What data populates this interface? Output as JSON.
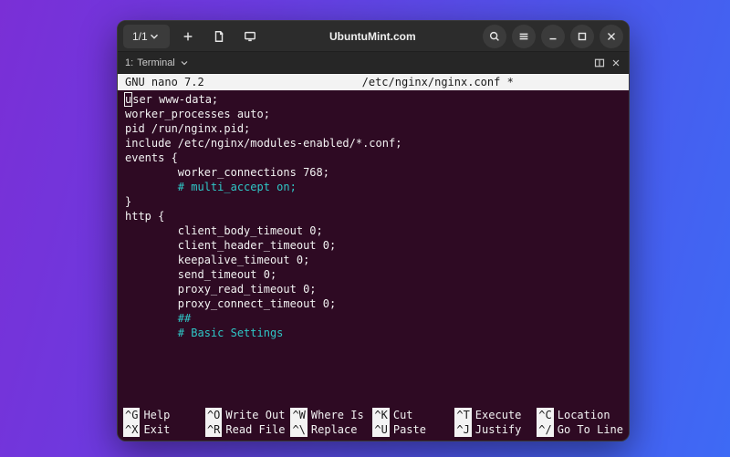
{
  "header": {
    "tab_counter": "1/1",
    "title": "UbuntuMint.com"
  },
  "tabstrip": {
    "tab_index": "1:",
    "tab_label": "Terminal"
  },
  "nano": {
    "app": "GNU nano 7.2",
    "filename": "/etc/nginx/nginx.conf *",
    "lines": [
      {
        "t": "ser www-data;",
        "style": "plain",
        "cursor_first": "u"
      },
      {
        "t": "worker_processes auto;",
        "style": "plain"
      },
      {
        "t": "pid /run/nginx.pid;",
        "style": "plain"
      },
      {
        "t": "include /etc/nginx/modules-enabled/*.conf;",
        "style": "plain"
      },
      {
        "t": "",
        "style": "plain"
      },
      {
        "t": "events {",
        "style": "plain"
      },
      {
        "t": "        worker_connections 768;",
        "style": "plain"
      },
      {
        "t": "        # multi_accept on;",
        "style": "comment"
      },
      {
        "t": "}",
        "style": "plain"
      },
      {
        "t": "",
        "style": "plain"
      },
      {
        "t": "http {",
        "style": "plain"
      },
      {
        "t": "        client_body_timeout 0;",
        "style": "plain"
      },
      {
        "t": "        client_header_timeout 0;",
        "style": "plain"
      },
      {
        "t": "        keepalive_timeout 0;",
        "style": "plain"
      },
      {
        "t": "        send_timeout 0;",
        "style": "plain"
      },
      {
        "t": "        proxy_read_timeout 0;",
        "style": "plain"
      },
      {
        "t": "        proxy_connect_timeout 0;",
        "style": "plain"
      },
      {
        "t": "",
        "style": "plain"
      },
      {
        "t": "        ##",
        "style": "comment"
      },
      {
        "t": "        # Basic Settings",
        "style": "comment"
      }
    ]
  },
  "help": [
    {
      "key": "^G",
      "label": "Help"
    },
    {
      "key": "^O",
      "label": "Write Out"
    },
    {
      "key": "^W",
      "label": "Where Is"
    },
    {
      "key": "^K",
      "label": "Cut"
    },
    {
      "key": "^T",
      "label": "Execute"
    },
    {
      "key": "^C",
      "label": "Location"
    },
    {
      "key": "^X",
      "label": "Exit"
    },
    {
      "key": "^R",
      "label": "Read File"
    },
    {
      "key": "^\\",
      "label": "Replace"
    },
    {
      "key": "^U",
      "label": "Paste"
    },
    {
      "key": "^J",
      "label": "Justify"
    },
    {
      "key": "^/",
      "label": "Go To Line"
    }
  ]
}
